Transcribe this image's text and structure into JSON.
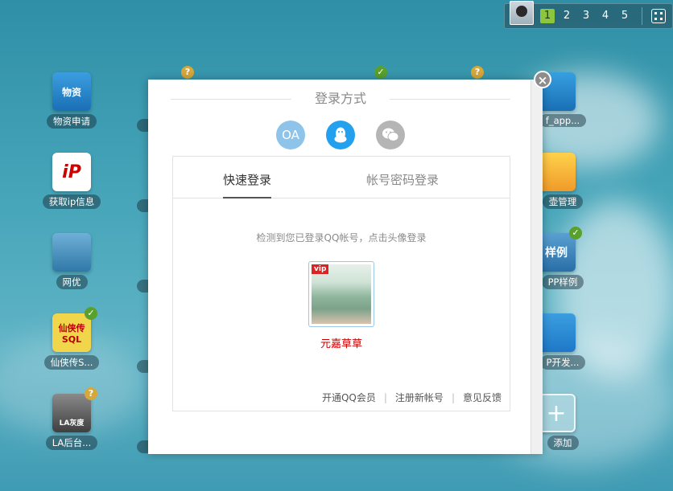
{
  "topbar": {
    "pages": [
      "1",
      "2",
      "3",
      "4",
      "5"
    ],
    "active_page": "1"
  },
  "desktop": {
    "apps": [
      {
        "label": "物资申请",
        "glyph": "物资",
        "badge": ""
      },
      {
        "label": "获取ip信息",
        "glyph": "iP",
        "badge": ""
      },
      {
        "label": "网优",
        "glyph": "",
        "badge": ""
      },
      {
        "label": "仙侠传S...",
        "glyph": "仙侠传 SQL",
        "badge": "ok"
      },
      {
        "label": "LA后台...",
        "glyph": "LA灰度",
        "badge": "q"
      },
      {
        "label": "f_app...",
        "glyph": "",
        "badge": ""
      },
      {
        "label": "壶管理",
        "glyph": "",
        "badge": ""
      },
      {
        "label": "PP样例",
        "glyph": "样例",
        "badge": "ok"
      },
      {
        "label": "P开发...",
        "glyph": "",
        "badge": ""
      },
      {
        "label": "添加",
        "glyph": "+",
        "badge": ""
      }
    ]
  },
  "modal": {
    "title": "登录方式",
    "close_label": "×",
    "methods": {
      "oa": "OA"
    },
    "tabs": {
      "quick": "快速登录",
      "password": "帐号密码登录"
    },
    "hint": "检测到您已登录QQ帐号，点击头像登录",
    "account": {
      "vip": "vip",
      "name": "元嘉草草"
    },
    "links": {
      "open_member": "开通QQ会员",
      "register": "注册新帐号",
      "feedback": "意见反馈"
    }
  }
}
